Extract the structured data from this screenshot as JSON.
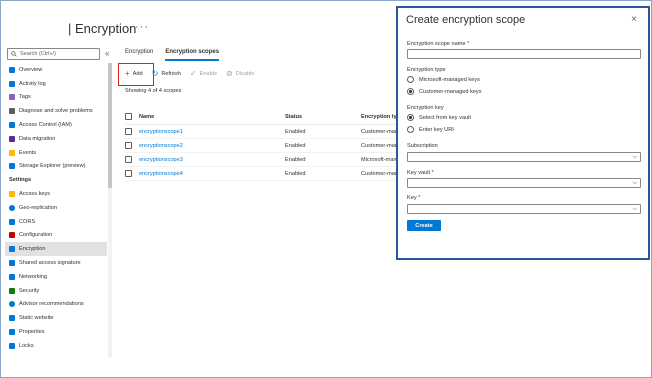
{
  "header": {
    "title": "| Encryption",
    "more": "···"
  },
  "sidebar": {
    "search_placeholder": "Search (Ctrl+/)",
    "collapse": "«",
    "items_top": [
      {
        "label": "Overview",
        "icon": "overview-icon",
        "color": "#0078d4"
      },
      {
        "label": "Activity log",
        "icon": "activity-log-icon",
        "color": "#0078d4"
      },
      {
        "label": "Tags",
        "icon": "tag-icon",
        "color": "#8764b8"
      },
      {
        "label": "Diagnose and solve problems",
        "icon": "wrench-icon",
        "color": "#605e5c"
      },
      {
        "label": "Access Control (IAM)",
        "icon": "people-icon",
        "color": "#0078d4"
      },
      {
        "label": "Data migration",
        "icon": "migration-icon",
        "color": "#5c2d91"
      },
      {
        "label": "Events",
        "icon": "lightning-icon",
        "color": "#ffb900"
      },
      {
        "label": "Storage Explorer (preview)",
        "icon": "storage-explorer-icon",
        "color": "#0078d4"
      }
    ],
    "section_settings": "Settings",
    "items_settings": [
      {
        "label": "Access keys",
        "icon": "key-icon",
        "color": "#ffb900"
      },
      {
        "label": "Geo-replication",
        "icon": "globe-icon",
        "color": "#0078d4"
      },
      {
        "label": "CORS",
        "icon": "cors-icon",
        "color": "#0078d4"
      },
      {
        "label": "Configuration",
        "icon": "configuration-icon",
        "color": "#c00"
      },
      {
        "label": "Encryption",
        "icon": "lock-icon",
        "color": "#0078d4"
      },
      {
        "label": "Shared access signature",
        "icon": "link-icon",
        "color": "#0078d4"
      },
      {
        "label": "Networking",
        "icon": "network-icon",
        "color": "#0078d4"
      },
      {
        "label": "Security",
        "icon": "shield-icon",
        "color": "#107c10"
      },
      {
        "label": "Advisor recommendations",
        "icon": "advisor-icon",
        "color": "#0078d4"
      },
      {
        "label": "Static website",
        "icon": "website-icon",
        "color": "#0078d4"
      },
      {
        "label": "Properties",
        "icon": "properties-icon",
        "color": "#0078d4"
      },
      {
        "label": "Locks",
        "icon": "locks-icon",
        "color": "#0078d4"
      }
    ]
  },
  "tabs": [
    {
      "label": "Encryption",
      "active": false
    },
    {
      "label": "Encryption scopes",
      "active": true
    }
  ],
  "toolbar": {
    "add": "Add",
    "refresh": "Refresh",
    "enable": "Enable",
    "disable": "Disable"
  },
  "showing": "Showing 4 of 4 scopes",
  "table": {
    "headers": {
      "name": "Name",
      "status": "Status",
      "type": "Encryption type"
    },
    "rows": [
      {
        "name": "encryptionscope1",
        "status": "Enabled",
        "type": "Customer-managed"
      },
      {
        "name": "encryptionscope2",
        "status": "Enabled",
        "type": "Customer-managed"
      },
      {
        "name": "encryptionscope3",
        "status": "Enabled",
        "type": "Microsoft-managed"
      },
      {
        "name": "encryptionscope4",
        "status": "Enabled",
        "type": "Customer-managed"
      }
    ]
  },
  "panel": {
    "title": "Create encryption scope",
    "close": "×",
    "scope_name_label": "Encryption scope name",
    "scope_name_value": "",
    "encryption_type_label": "Encryption type",
    "encryption_type_options": [
      {
        "label": "Microsoft-managed keys",
        "selected": false
      },
      {
        "label": "Customer-managed keys",
        "selected": true
      }
    ],
    "encryption_key_label": "Encryption key",
    "encryption_key_options": [
      {
        "label": "Select from key vault",
        "selected": true
      },
      {
        "label": "Enter key URI",
        "selected": false
      }
    ],
    "subscription_label": "Subscription",
    "subscription_value": "",
    "key_vault_label": "Key vault",
    "key_vault_value": "",
    "key_label": "Key",
    "key_value": "",
    "required_mark": "*",
    "create": "Create"
  },
  "colors": {
    "accent": "#0078d4",
    "highlight": "#e02020",
    "panel_border": "#2b579a"
  }
}
